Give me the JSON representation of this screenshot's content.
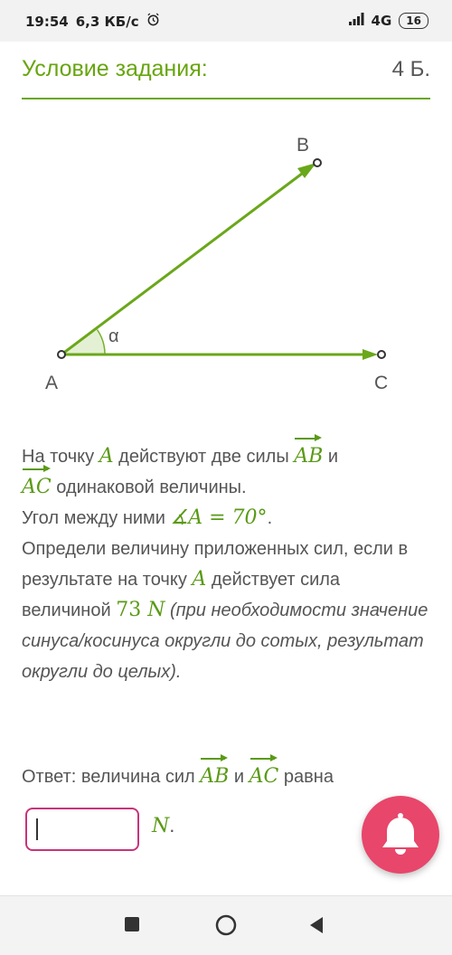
{
  "status_bar": {
    "time": "19:54",
    "speed": "6,3 КБ/с",
    "network": "4G",
    "battery": "16"
  },
  "header": {
    "title": "Условие задания:",
    "points": "4 Б."
  },
  "diagram": {
    "label_a": "A",
    "label_b": "B",
    "label_c": "C",
    "label_alpha": "α"
  },
  "problem": {
    "t1": "На точку ",
    "point": "A",
    "t2": " действуют две силы ",
    "vec_ab": "AB",
    "t3": " и",
    "vec_ac": "AC",
    "t4": " одинаковой величины.",
    "t5": "Угол между ними ",
    "angle_expr": "∡A = 70°",
    "t6": ".",
    "t7": "Определи величину приложенных сил, если в результате на точку ",
    "point2": "A",
    "t8": " действует сила величиной ",
    "force_value": "73 ",
    "force_unit": "N",
    "note": " (при необходимости значение синуса/косинуса округли до сотых, результат округли до целых)."
  },
  "answer": {
    "t1": "Ответ: величина сил ",
    "vec_ab": "AB",
    "t2": " и ",
    "vec_ac": "AC",
    "t3": " равна",
    "input_value": "",
    "unit": "N",
    "unit_dot": "."
  },
  "colors": {
    "accent_green": "#67a50e",
    "input_border": "#c8337a",
    "bell_bg": "#e8466a"
  }
}
